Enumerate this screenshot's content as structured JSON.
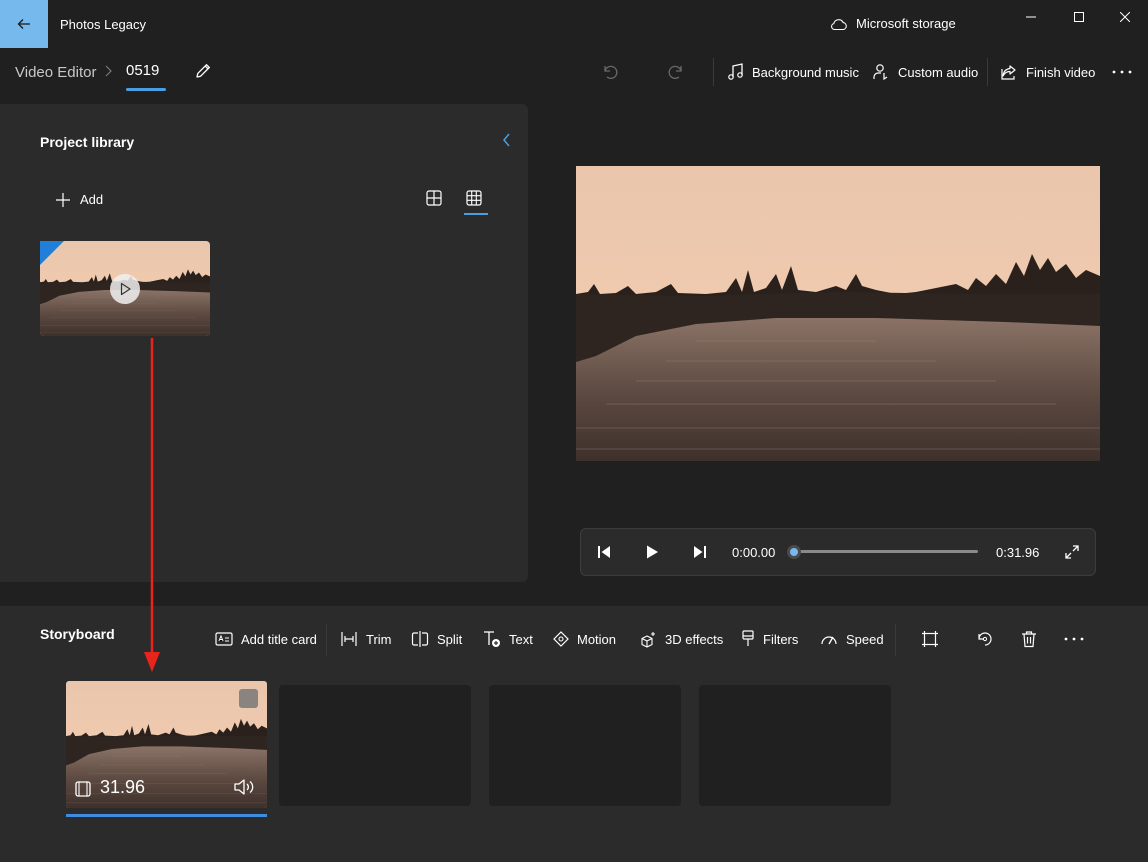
{
  "titlebar": {
    "app_title": "Photos Legacy",
    "storage_label": "Microsoft storage"
  },
  "header": {
    "breadcrumb_root": "Video Editor",
    "project_name": "0519",
    "background_music": "Background music",
    "custom_audio": "Custom audio",
    "finish_video": "Finish video"
  },
  "library": {
    "title": "Project library",
    "add_label": "Add"
  },
  "player": {
    "time_current": "0:00.00",
    "time_total": "0:31.96",
    "progress": 0
  },
  "storyboard": {
    "title": "Storyboard",
    "tools": {
      "add_title_card": "Add title card",
      "trim": "Trim",
      "split": "Split",
      "text": "Text",
      "motion": "Motion",
      "effects_3d": "3D effects",
      "filters": "Filters",
      "speed": "Speed"
    },
    "clip": {
      "duration": "31.96"
    }
  },
  "colors": {
    "accent": "#4a9fe0",
    "back_button": "#76b9ed",
    "annotation_arrow": "#e8251c"
  }
}
